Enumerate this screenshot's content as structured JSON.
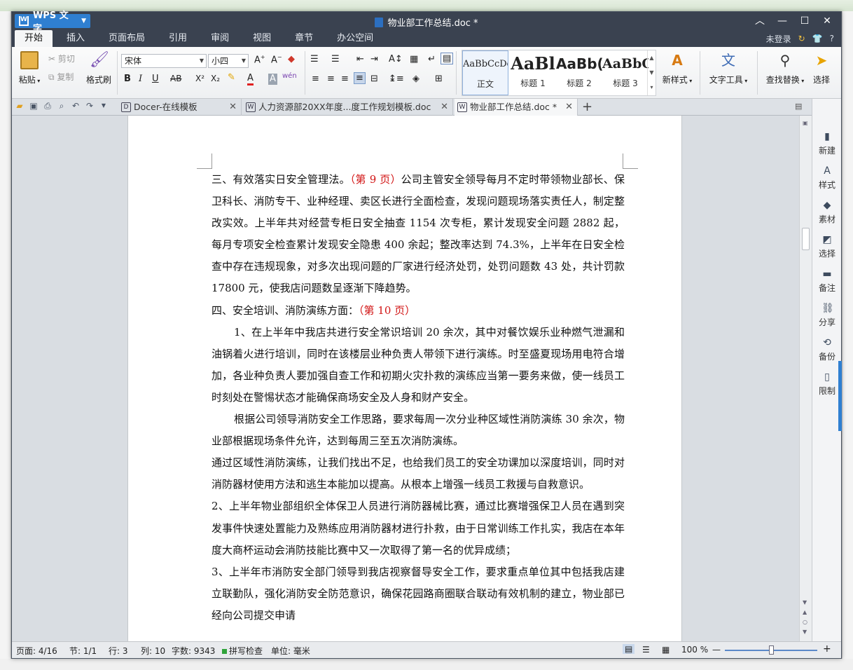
{
  "window": {
    "app_name": "WPS 文字",
    "title": "物业部工作总结.doc *"
  },
  "menu": {
    "tabs": [
      "开始",
      "插入",
      "页面布局",
      "引用",
      "审阅",
      "视图",
      "章节",
      "办公空间"
    ],
    "login": "未登录",
    "help": "?"
  },
  "ribbon": {
    "paste": "粘贴",
    "cut": "剪切",
    "copy": "复制",
    "format_painter": "格式刷",
    "font_name": "宋体",
    "font_size": "小四",
    "styles": [
      {
        "sample": "AaBbCcDd",
        "label": "正文"
      },
      {
        "sample": "AaBl",
        "label": "标题 1"
      },
      {
        "sample": "AaBb(",
        "label": "标题 2"
      },
      {
        "sample": "AaBbC",
        "label": "标题 3"
      }
    ],
    "new_style": "新样式",
    "text_tools": "文字工具",
    "find_replace": "查找替换",
    "select": "选择",
    "bold": "B",
    "italic": "I",
    "underline": "U",
    "strike": "AB",
    "superscript": "X²",
    "subscript": "X₂",
    "font_color": "A",
    "char_shade": "A",
    "phonetic": "wén"
  },
  "doc_tabs": [
    {
      "label": "Docer-在线模板"
    },
    {
      "label": "人力资源部20XX年度...度工作规划模板.doc"
    },
    {
      "label": "物业部工作总结.doc *"
    }
  ],
  "document": {
    "p1_a": "三、有效落实日安全管理法。",
    "p1_red": "（第 9 页）",
    "p1_b": "公司主管安全领导每月不定时带领物业部长、保卫科长、消防专干、业种经理、卖区长进行全面检查，发现问题现场落实责任人，制定整改实效。上半年共对经营专柜日安全抽查 1154 次专柜，累计发现安全问题 2882 起，每月专项安全检查累计发现安全隐患 400 余起；整改率达到 74.3%，上半年在日安全检查中存在违规现象，对多次出现问题的厂家进行经济处罚，处罚问题数 43 处，共计罚款 17800 元，使我店问题数呈逐渐下降趋势。",
    "p2_a": "四、安全培训、消防演练方面：",
    "p2_red": "（第 10 页）",
    "p3": "1、在上半年中我店共进行安全常识培训 20 余次，其中对餐饮娱乐业种燃气泄漏和油锅着火进行培训，同时在该楼层业种负责人带领下进行演练。时至盛夏现场用电符合增加，各业种负责人要加强自查工作和初期火灾扑救的演练应当第一要务来做，使一线员工时刻处在警惕状态才能确保商场安全及人身和财产安全。",
    "p4": "根据公司领导消防安全工作思路，要求每周一次分业种区域性消防演练 30 余次，物业部根据现场条件允许，达到每周三至五次消防演练。",
    "p5": "通过区域性消防演练，让我们找出不足，也给我们员工的安全功课加以深度培训，同时对消防器材使用方法和逃生本能加以提高。从根本上增强一线员工救援与自救意识。",
    "p6": "2、上半年物业部组织全体保卫人员进行消防器械比赛，通过比赛增强保卫人员在遇到突发事件快速处置能力及熟练应用消防器材进行扑救，由于日常训练工作扎实，我店在本年度大商杯运动会消防技能比赛中又一次取得了第一名的优异成绩；",
    "p7": "3、上半年市消防安全部门领导到我店视察督导安全工作，要求重点单位其中包括我店建立联勤队，强化消防安全防范意识，确保花园路商圈联合联动有效机制的建立，物业部已经向公司提交申请"
  },
  "side_panel": [
    "新建",
    "样式",
    "素材",
    "选择",
    "备注",
    "分享",
    "备份",
    "限制"
  ],
  "status": {
    "page": "页面: 4/16",
    "section": "节: 1/1",
    "row": "行: 3",
    "col": "列: 10",
    "words": "字数: 9343",
    "spell": "拼写检查",
    "unit": "单位: 毫米",
    "zoom": "100 %",
    "zoom_level": 1.0
  }
}
